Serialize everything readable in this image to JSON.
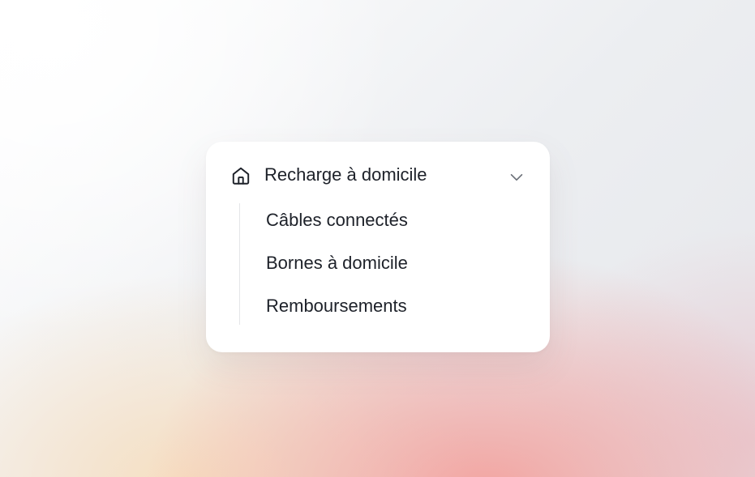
{
  "menu": {
    "header": {
      "label": "Recharge à domicile",
      "icon": "home-icon",
      "toggle_icon": "chevron-down-icon",
      "expanded": true
    },
    "items": [
      {
        "label": "Câbles connectés"
      },
      {
        "label": "Bornes à domicile"
      },
      {
        "label": "Remboursements"
      }
    ]
  },
  "colors": {
    "text": "#1d2129",
    "chevron": "#6b7078",
    "divider": "#e4e5e8",
    "card": "#ffffff"
  }
}
